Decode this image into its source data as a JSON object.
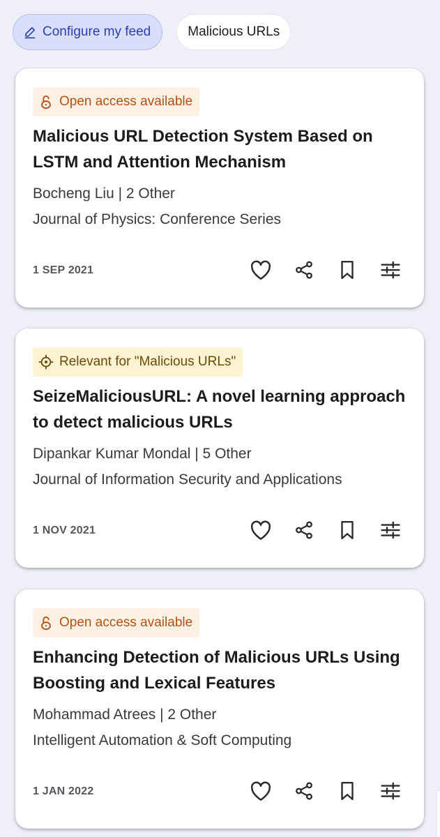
{
  "filters": {
    "configure_label": "Configure my feed",
    "topic_label": "Malicious URLs"
  },
  "colors": {
    "page_bg": "#eeeff8",
    "accent": "#2b3fae",
    "open_access": "#b45112",
    "relevant": "#6b4a09"
  },
  "articles": [
    {
      "badge_type": "open-access",
      "badge_icon": "open-lock-icon",
      "badge": "Open access available",
      "title": "Malicious URL Detection System Based on LSTM and Attention Mechanism",
      "authors": "Bocheng Liu | 2 Other",
      "journal": "Journal of Physics: Conference Series",
      "date": "1 SEP 2021"
    },
    {
      "badge_type": "relevant",
      "badge_icon": "target-icon",
      "badge": "Relevant for \"Malicious URLs\"",
      "title": "SeizeMaliciousURL: A novel learning approach to detect malicious URLs",
      "authors": "Dipankar Kumar Mondal | 5 Other",
      "journal": "Journal of Information Security and Applications",
      "date": "1 NOV 2021"
    },
    {
      "badge_type": "open-access",
      "badge_icon": "open-lock-icon",
      "badge": "Open access available",
      "title": "Enhancing Detection of Malicious URLs Using Boosting and Lexical Features",
      "authors": "Mohammad Atrees | 2 Other",
      "journal": "Intelligent Automation & Soft Computing",
      "date": "1 JAN 2022"
    }
  ],
  "action_icons": [
    "heart-icon",
    "share-icon",
    "bookmark-icon",
    "sliders-icon"
  ]
}
